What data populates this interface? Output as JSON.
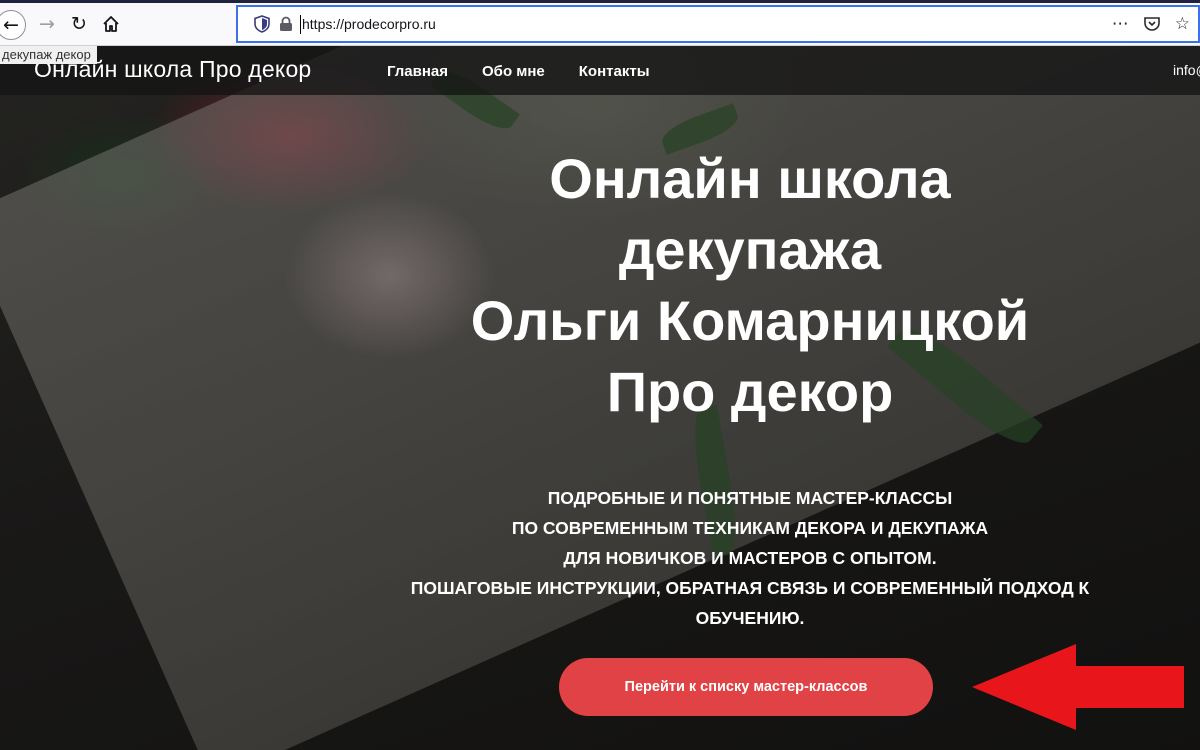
{
  "browser": {
    "url": "https://prodecorpro.ru",
    "tab_tooltip": "декупаж декор",
    "icons": {
      "back": "back-arrow-icon",
      "forward": "forward-arrow-icon",
      "reload": "reload-icon",
      "home": "home-icon",
      "tracking": "shield-icon",
      "lock": "lock-icon",
      "more": "more-icon",
      "pocket": "pocket-icon",
      "bookmark": "star-icon"
    }
  },
  "site": {
    "logo": "Онлайн школа Про декор",
    "nav": [
      "Главная",
      "Обо мне",
      "Контакты"
    ],
    "email": "info@"
  },
  "hero": {
    "title_lines": [
      "Онлайн школа",
      "декупажа",
      "Ольги Комарницкой",
      "Про декор"
    ],
    "subtitle_lines": [
      "ПОДРОБНЫЕ И ПОНЯТНЫЕ МАСТЕР-КЛАССЫ",
      "ПО СОВРЕМЕННЫМ ТЕХНИКАМ ДЕКОРА И ДЕКУПАЖА",
      "ДЛЯ НОВИЧКОВ И МАСТЕРОВ С ОПЫТОМ.",
      "ПОШАГОВЫЕ ИНСТРУКЦИИ, ОБРАТНАЯ СВЯЗЬ И СОВРЕМЕННЫЙ ПОДХОД К",
      "ОБУЧЕНИЮ."
    ],
    "cta_label": "Перейти к списку мастер-классов"
  },
  "colors": {
    "cta": "#e04245",
    "annotation_arrow": "#e8161b",
    "urlbar_focus": "#3b72e8"
  }
}
